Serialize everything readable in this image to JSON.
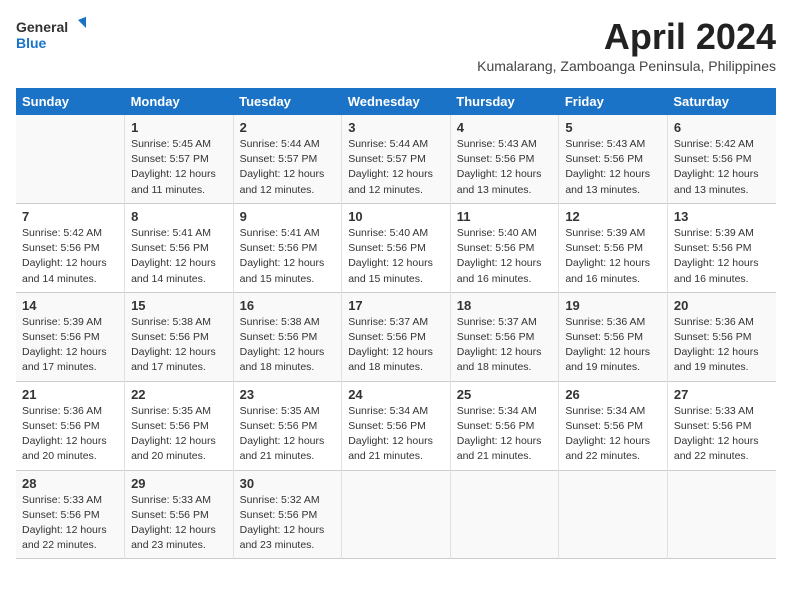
{
  "header": {
    "logo_general": "General",
    "logo_blue": "Blue",
    "month_title": "April 2024",
    "subtitle": "Kumalarang, Zamboanga Peninsula, Philippines"
  },
  "days_of_week": [
    "Sunday",
    "Monday",
    "Tuesday",
    "Wednesday",
    "Thursday",
    "Friday",
    "Saturday"
  ],
  "weeks": [
    [
      {
        "day": "",
        "info": ""
      },
      {
        "day": "1",
        "info": "Sunrise: 5:45 AM\nSunset: 5:57 PM\nDaylight: 12 hours\nand 11 minutes."
      },
      {
        "day": "2",
        "info": "Sunrise: 5:44 AM\nSunset: 5:57 PM\nDaylight: 12 hours\nand 12 minutes."
      },
      {
        "day": "3",
        "info": "Sunrise: 5:44 AM\nSunset: 5:57 PM\nDaylight: 12 hours\nand 12 minutes."
      },
      {
        "day": "4",
        "info": "Sunrise: 5:43 AM\nSunset: 5:56 PM\nDaylight: 12 hours\nand 13 minutes."
      },
      {
        "day": "5",
        "info": "Sunrise: 5:43 AM\nSunset: 5:56 PM\nDaylight: 12 hours\nand 13 minutes."
      },
      {
        "day": "6",
        "info": "Sunrise: 5:42 AM\nSunset: 5:56 PM\nDaylight: 12 hours\nand 13 minutes."
      }
    ],
    [
      {
        "day": "7",
        "info": "Sunrise: 5:42 AM\nSunset: 5:56 PM\nDaylight: 12 hours\nand 14 minutes."
      },
      {
        "day": "8",
        "info": "Sunrise: 5:41 AM\nSunset: 5:56 PM\nDaylight: 12 hours\nand 14 minutes."
      },
      {
        "day": "9",
        "info": "Sunrise: 5:41 AM\nSunset: 5:56 PM\nDaylight: 12 hours\nand 15 minutes."
      },
      {
        "day": "10",
        "info": "Sunrise: 5:40 AM\nSunset: 5:56 PM\nDaylight: 12 hours\nand 15 minutes."
      },
      {
        "day": "11",
        "info": "Sunrise: 5:40 AM\nSunset: 5:56 PM\nDaylight: 12 hours\nand 16 minutes."
      },
      {
        "day": "12",
        "info": "Sunrise: 5:39 AM\nSunset: 5:56 PM\nDaylight: 12 hours\nand 16 minutes."
      },
      {
        "day": "13",
        "info": "Sunrise: 5:39 AM\nSunset: 5:56 PM\nDaylight: 12 hours\nand 16 minutes."
      }
    ],
    [
      {
        "day": "14",
        "info": "Sunrise: 5:39 AM\nSunset: 5:56 PM\nDaylight: 12 hours\nand 17 minutes."
      },
      {
        "day": "15",
        "info": "Sunrise: 5:38 AM\nSunset: 5:56 PM\nDaylight: 12 hours\nand 17 minutes."
      },
      {
        "day": "16",
        "info": "Sunrise: 5:38 AM\nSunset: 5:56 PM\nDaylight: 12 hours\nand 18 minutes."
      },
      {
        "day": "17",
        "info": "Sunrise: 5:37 AM\nSunset: 5:56 PM\nDaylight: 12 hours\nand 18 minutes."
      },
      {
        "day": "18",
        "info": "Sunrise: 5:37 AM\nSunset: 5:56 PM\nDaylight: 12 hours\nand 18 minutes."
      },
      {
        "day": "19",
        "info": "Sunrise: 5:36 AM\nSunset: 5:56 PM\nDaylight: 12 hours\nand 19 minutes."
      },
      {
        "day": "20",
        "info": "Sunrise: 5:36 AM\nSunset: 5:56 PM\nDaylight: 12 hours\nand 19 minutes."
      }
    ],
    [
      {
        "day": "21",
        "info": "Sunrise: 5:36 AM\nSunset: 5:56 PM\nDaylight: 12 hours\nand 20 minutes."
      },
      {
        "day": "22",
        "info": "Sunrise: 5:35 AM\nSunset: 5:56 PM\nDaylight: 12 hours\nand 20 minutes."
      },
      {
        "day": "23",
        "info": "Sunrise: 5:35 AM\nSunset: 5:56 PM\nDaylight: 12 hours\nand 21 minutes."
      },
      {
        "day": "24",
        "info": "Sunrise: 5:34 AM\nSunset: 5:56 PM\nDaylight: 12 hours\nand 21 minutes."
      },
      {
        "day": "25",
        "info": "Sunrise: 5:34 AM\nSunset: 5:56 PM\nDaylight: 12 hours\nand 21 minutes."
      },
      {
        "day": "26",
        "info": "Sunrise: 5:34 AM\nSunset: 5:56 PM\nDaylight: 12 hours\nand 22 minutes."
      },
      {
        "day": "27",
        "info": "Sunrise: 5:33 AM\nSunset: 5:56 PM\nDaylight: 12 hours\nand 22 minutes."
      }
    ],
    [
      {
        "day": "28",
        "info": "Sunrise: 5:33 AM\nSunset: 5:56 PM\nDaylight: 12 hours\nand 22 minutes."
      },
      {
        "day": "29",
        "info": "Sunrise: 5:33 AM\nSunset: 5:56 PM\nDaylight: 12 hours\nand 23 minutes."
      },
      {
        "day": "30",
        "info": "Sunrise: 5:32 AM\nSunset: 5:56 PM\nDaylight: 12 hours\nand 23 minutes."
      },
      {
        "day": "",
        "info": ""
      },
      {
        "day": "",
        "info": ""
      },
      {
        "day": "",
        "info": ""
      },
      {
        "day": "",
        "info": ""
      }
    ]
  ]
}
